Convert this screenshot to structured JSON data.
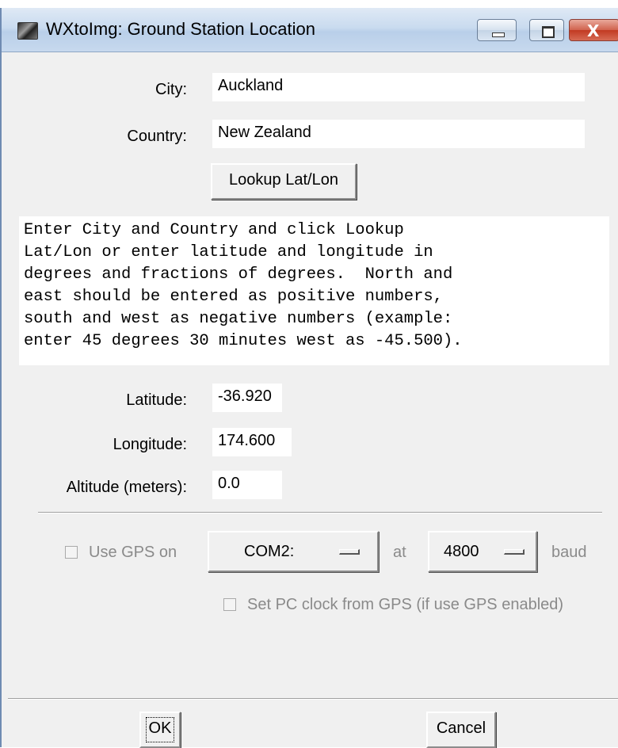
{
  "window": {
    "title": "WXtoImg: Ground Station Location",
    "icons": [
      "app-icon",
      "minimize-icon",
      "maximize-icon",
      "close-icon"
    ]
  },
  "location": {
    "city_label": "City:",
    "city_value": "Auckland",
    "country_label": "Country:",
    "country_value": "New Zealand",
    "lookup_label": "Lookup Lat/Lon"
  },
  "info_lines": [
    "Enter City and Country and click Lookup",
    "Lat/Lon or enter latitude and longitude in",
    "degrees and fractions of degrees.  North and",
    "east should be entered as positive numbers,",
    "south and west as negative numbers (example:",
    "enter 45 degrees 30 minutes west as -45.500)."
  ],
  "coords": {
    "latitude_label": "Latitude:",
    "latitude_value": "-36.920",
    "longitude_label": "Longitude:",
    "longitude_value": "174.600",
    "altitude_label": "Altitude (meters):",
    "altitude_value": "0.0"
  },
  "gps": {
    "use_gps_label": "Use GPS on",
    "use_gps_checked": false,
    "port_value": "COM2:",
    "at_label": "at",
    "baud_value": "4800",
    "baud_label": "baud",
    "set_clock_label": "Set PC clock from GPS (if use GPS enabled)",
    "set_clock_checked": false,
    "disabled_color": "#8a8a8a"
  },
  "footer": {
    "ok_label": "OK",
    "cancel_label": "Cancel"
  }
}
